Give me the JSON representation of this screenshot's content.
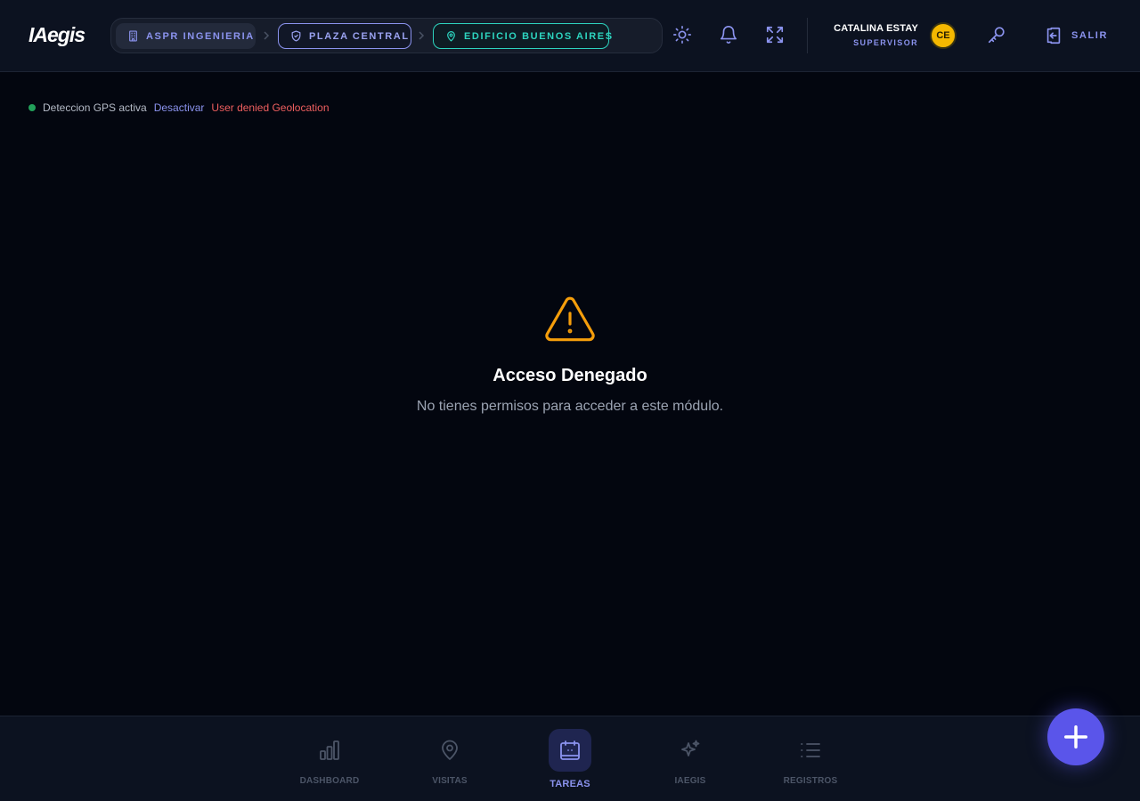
{
  "header": {
    "logo": "IAegis",
    "breadcrumbs": [
      {
        "label": "ASPR INGENIERIA",
        "icon": "building-icon"
      },
      {
        "label": "PLAZA CENTRAL",
        "icon": "shield-icon"
      },
      {
        "label": "EDIFICIO BUENOS AIRES",
        "icon": "map-pin-icon"
      }
    ],
    "actions": {
      "theme": "sun-icon",
      "notifications": "bell-icon",
      "fullscreen": "expand-icon",
      "password": "key-icon"
    },
    "user": {
      "name": "CATALINA ESTAY",
      "role": "SUPERVISOR",
      "initials": "CE"
    },
    "logout_label": "SALIR"
  },
  "gps": {
    "status": "Deteccion GPS activa",
    "action": "Desactivar",
    "error": "User denied Geolocation"
  },
  "main": {
    "title": "Acceso Denegado",
    "message": "No tienes permisos para acceder a este módulo."
  },
  "bottom_nav": [
    {
      "label": "DASHBOARD",
      "icon": "bar-chart-icon",
      "active": false
    },
    {
      "label": "VISITAS",
      "icon": "map-pin-icon",
      "active": false
    },
    {
      "label": "TAREAS",
      "icon": "calendar-icon",
      "active": true
    },
    {
      "label": "IAEGIS",
      "icon": "sparkles-icon",
      "active": false
    },
    {
      "label": "REGISTROS",
      "icon": "list-icon",
      "active": false
    }
  ],
  "colors": {
    "accent": "#8b93ee",
    "teal": "#2dd4bf",
    "warning": "#f59e0b",
    "error": "#ef5f5f",
    "fab": "#5a55ea"
  }
}
